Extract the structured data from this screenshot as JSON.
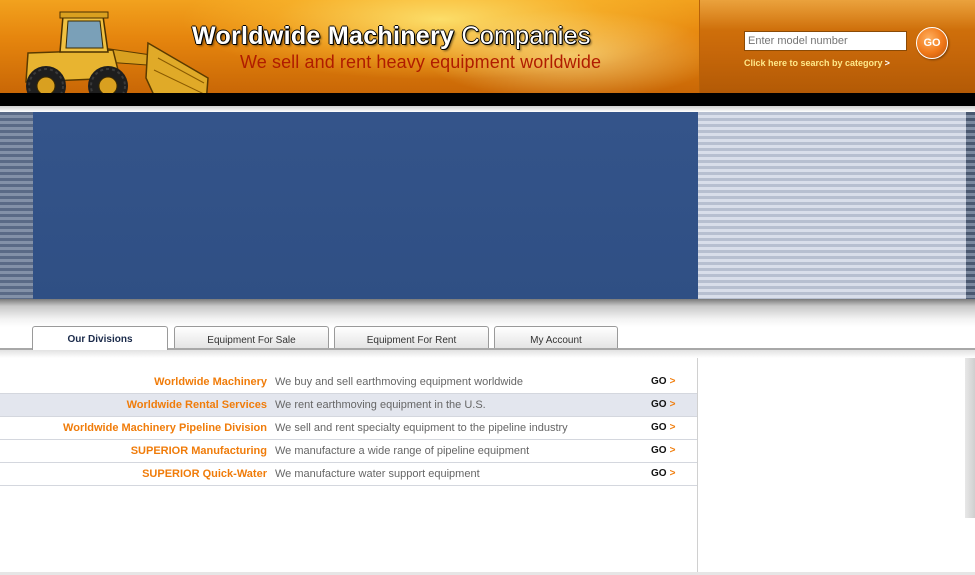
{
  "header": {
    "brand_bold": "Worldwide Machinery",
    "brand_light": "Companies",
    "tagline": "We sell and rent heavy equipment worldwide",
    "search": {
      "placeholder": "Enter model number",
      "go_label": "GO",
      "category_link": "Click here to search by category",
      "category_arrow": ">"
    }
  },
  "tabs": [
    {
      "label": "Our Divisions",
      "active": true
    },
    {
      "label": "Equipment For Sale",
      "active": false
    },
    {
      "label": "Equipment For Rent",
      "active": false
    },
    {
      "label": "My Account",
      "active": false
    }
  ],
  "divisions": [
    {
      "name": "Worldwide Machinery",
      "description": "We buy and sell earthmoving equipment worldwide",
      "go": "GO",
      "chevron": ">"
    },
    {
      "name": "Worldwide Rental Services",
      "description": "We rent earthmoving equipment in the U.S.",
      "go": "GO",
      "chevron": ">"
    },
    {
      "name": "Worldwide Machinery Pipeline Division",
      "description": "We sell and rent specialty equipment to the pipeline industry",
      "go": "GO",
      "chevron": ">"
    },
    {
      "name": "SUPERIOR Manufacturing",
      "description": "We manufacture a wide range of pipeline equipment",
      "go": "GO",
      "chevron": ">"
    },
    {
      "name": "SUPERIOR Quick-Water",
      "description": "We manufacture water support equipment",
      "go": "GO",
      "chevron": ">"
    }
  ],
  "colors": {
    "accent_orange": "#f07c0a",
    "hero_blue": "#2f4f84",
    "header_orange": "#e6860e"
  }
}
